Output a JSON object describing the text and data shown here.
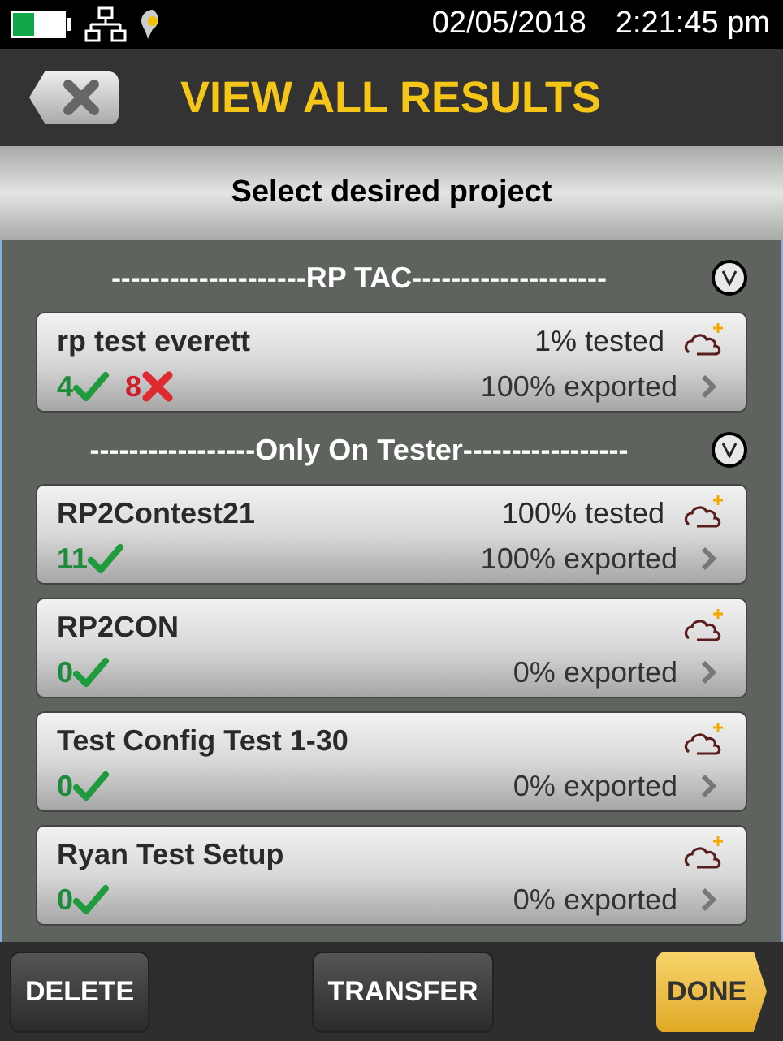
{
  "status_bar": {
    "date": "02/05/2018",
    "time": "2:21:45 pm"
  },
  "header": {
    "title": "VIEW ALL RESULTS"
  },
  "subheader": "Select desired project",
  "groups": [
    {
      "title": "--------------------RP TAC--------------------",
      "projects": [
        {
          "name": "rp test everett",
          "tested": "1% tested",
          "passed": "4",
          "failed": "8",
          "exported": "100% exported"
        }
      ]
    },
    {
      "title": "-----------------Only On Tester-----------------",
      "projects": [
        {
          "name": "RP2Contest21",
          "tested": "100% tested",
          "passed": "11",
          "exported": "100% exported"
        },
        {
          "name": "RP2CON",
          "passed": "0",
          "exported": "0% exported"
        },
        {
          "name": "Test Config Test 1-30",
          "passed": "0",
          "exported": "0% exported"
        },
        {
          "name": "Ryan Test Setup",
          "passed": "0",
          "exported": "0% exported"
        }
      ]
    }
  ],
  "buttons": {
    "delete": "DELETE",
    "transfer": "TRANSFER",
    "done": "DONE"
  }
}
